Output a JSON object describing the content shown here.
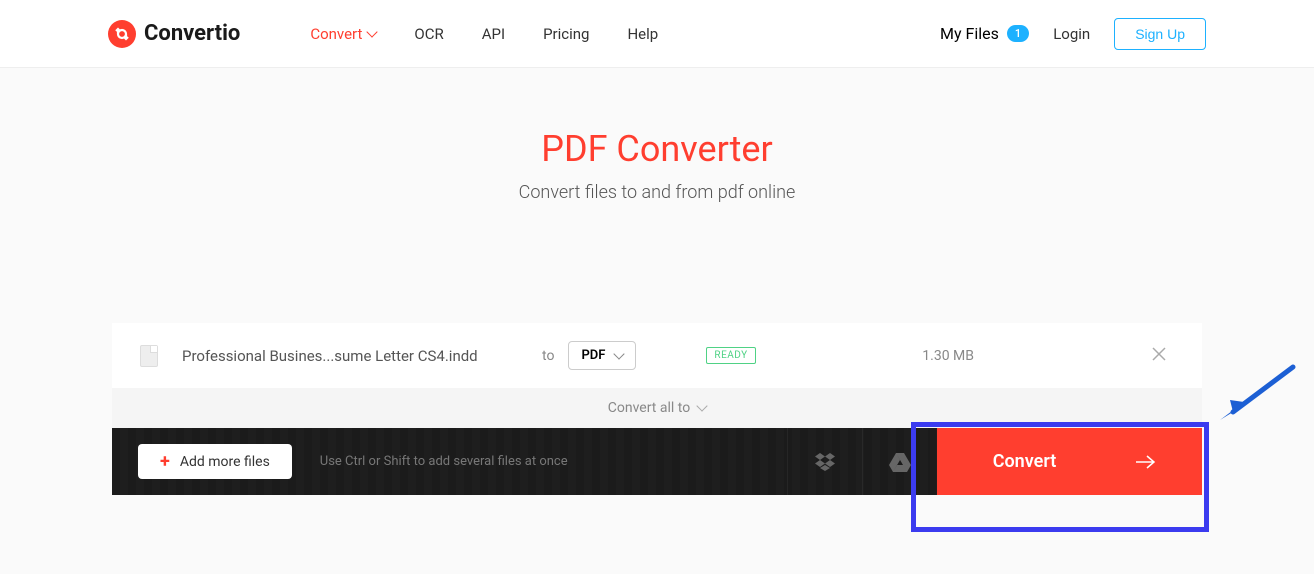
{
  "header": {
    "logo_text": "Convertio",
    "nav": {
      "convert": "Convert",
      "ocr": "OCR",
      "api": "API",
      "pricing": "Pricing",
      "help": "Help"
    },
    "my_files": "My Files",
    "badge_count": "1",
    "login": "Login",
    "signup": "Sign Up"
  },
  "main": {
    "title": "PDF Converter",
    "subtitle": "Convert files to and from pdf online"
  },
  "file": {
    "name": "Professional Busines...sume Letter CS4.indd",
    "to_label": "to",
    "format": "PDF",
    "status": "READY",
    "size": "1.30 MB"
  },
  "convert_all": "Convert all to",
  "bottom": {
    "add_more": "Add more files",
    "helper": "Use Ctrl or Shift to add several files at once",
    "convert": "Convert"
  }
}
